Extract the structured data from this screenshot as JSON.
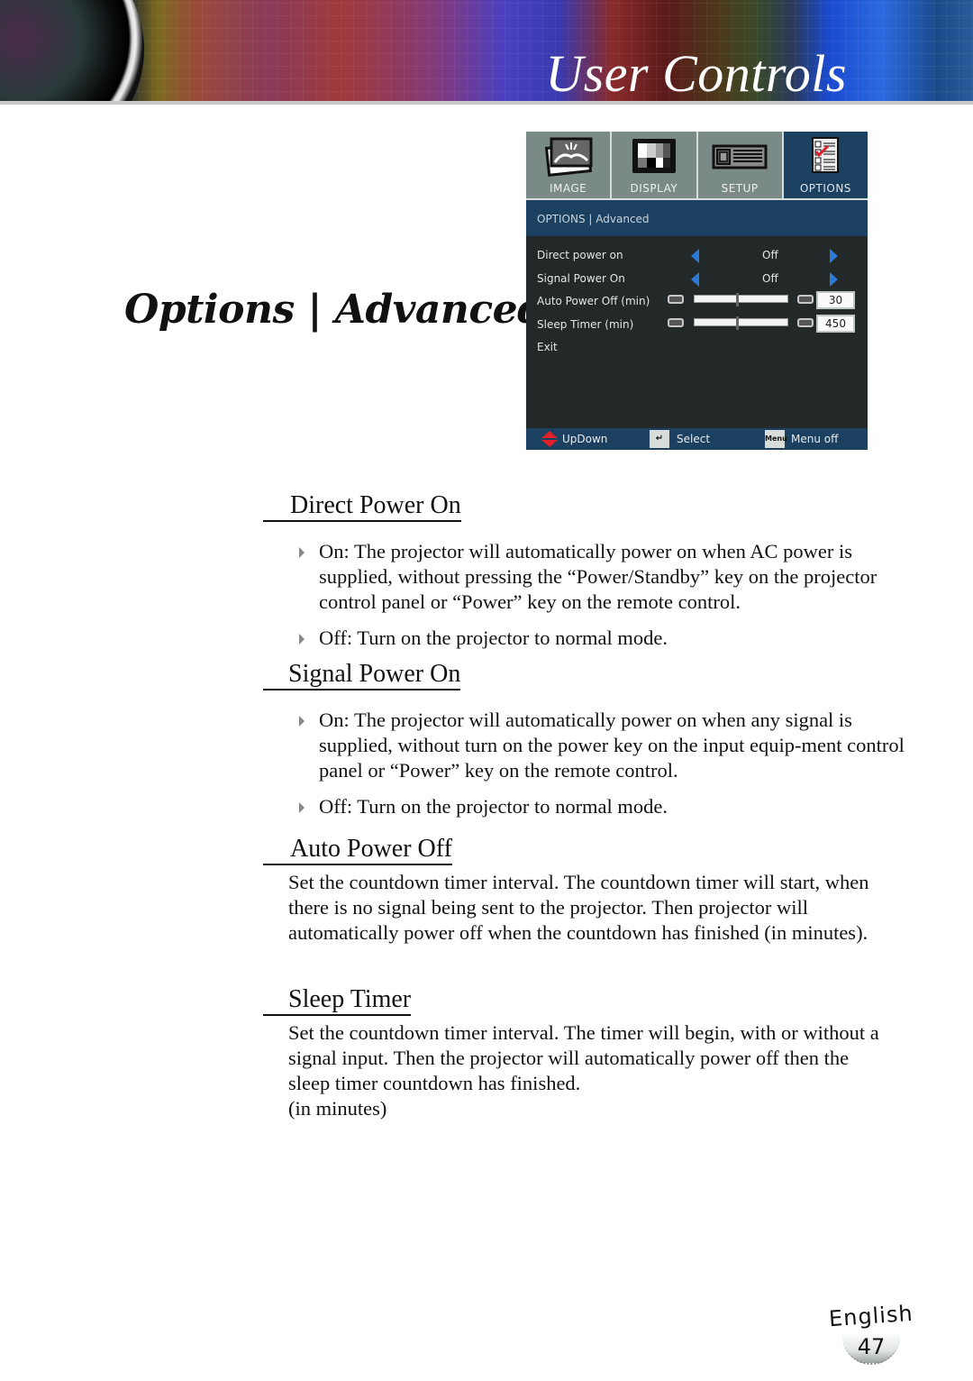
{
  "banner": {
    "title": "User Controls"
  },
  "section_title": "Options | Advanced",
  "osd": {
    "tabs": [
      {
        "label": "IMAGE",
        "icon": "image-icon",
        "active": false
      },
      {
        "label": "DISPLAY",
        "icon": "display-icon",
        "active": false
      },
      {
        "label": "SETUP",
        "icon": "projector-icon",
        "active": false
      },
      {
        "label": "OPTIONS",
        "icon": "checklist-icon",
        "active": true
      }
    ],
    "breadcrumb": "OPTIONS | Advanced",
    "rows": [
      {
        "label": "Direct power on",
        "type": "select",
        "value": "Off"
      },
      {
        "label": "Signal Power On",
        "type": "select",
        "value": "Off"
      },
      {
        "label": "Auto Power Off (min)",
        "type": "slider",
        "value": "30",
        "slider_fraction": 0.45
      },
      {
        "label": "Sleep Timer (min)",
        "type": "slider",
        "value": "450",
        "slider_fraction": 0.45
      },
      {
        "label": "Exit",
        "type": "action"
      }
    ],
    "footer": {
      "updown": "UpDown",
      "select": "Select",
      "menu_key": "Menu",
      "menu_off": "Menu off"
    },
    "colors": {
      "panel_bg": "#232829",
      "header_bg": "#1b4060",
      "tab_bg": "#7a8a87",
      "arrow": "#2a7ad6"
    }
  },
  "sections": {
    "direct_power_on": {
      "heading": "Direct Power On",
      "bullets": [
        "On: The projector will automatically power on when AC power is supplied, without pressing the “Power/Standby” key on the projector control panel or “Power” key on the remote control.",
        "Off: Turn on the projector to normal mode."
      ]
    },
    "signal_power_on": {
      "heading": "Signal Power On",
      "bullets": [
        "On: The projector will automatically power on when any signal is supplied, without turn on the power key on the input equip-ment control panel or “Power” key on the remote control.",
        "Off: Turn on the projector to normal mode."
      ]
    },
    "auto_power_off": {
      "heading": "Auto Power Off",
      "text": "Set the countdown timer interval. The countdown timer will start, when there is no signal being sent to the projector. Then projector will automatically power off when the countdown has finished (in minutes)."
    },
    "sleep_timer": {
      "heading": "Sleep Timer",
      "text": "Set the countdown timer interval. The timer will begin, with or without a signal input. Then the projector will automatically power off then the sleep timer countdown has finished.",
      "note": "(in minutes)"
    }
  },
  "footer": {
    "language": "English",
    "page_number": "47"
  }
}
